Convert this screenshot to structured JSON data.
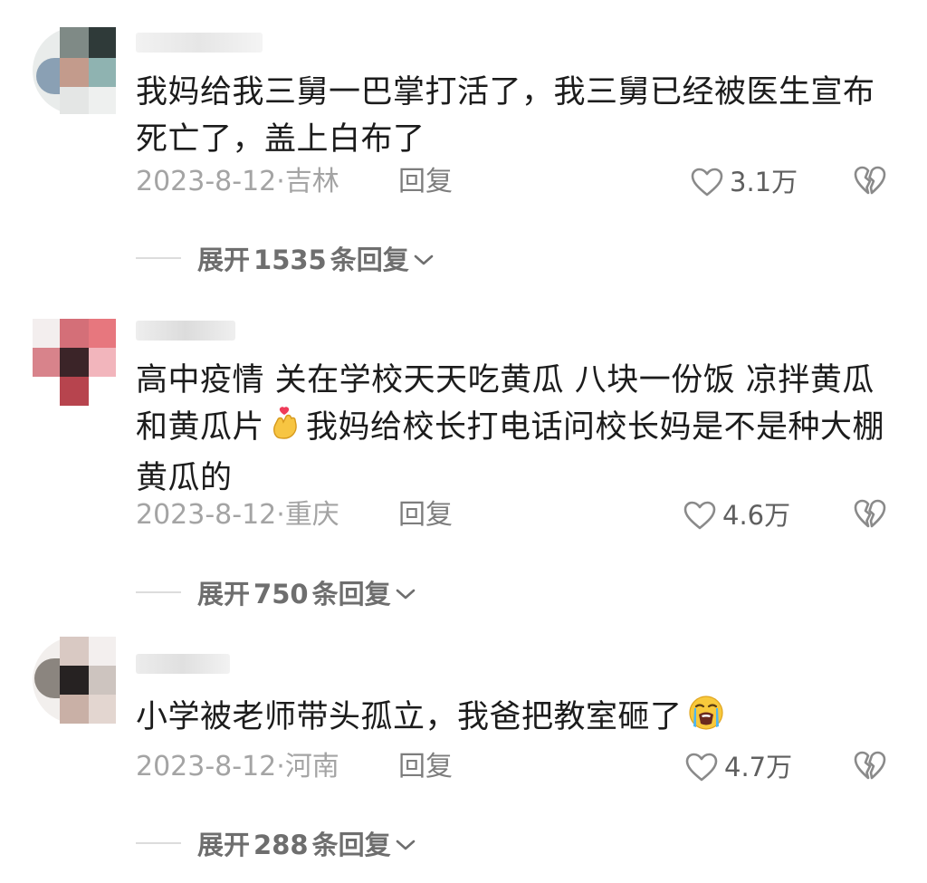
{
  "colors": {
    "text": "#1c1c1c",
    "meta": "#a4a4a4",
    "reply": "#7d7d7d",
    "count": "#5f5f5f",
    "expand": "#6e6e6e"
  },
  "comments": [
    {
      "text": "我妈给我三舅一巴掌打活了，我三舅已经被医生宣布死亡了，盖上白布了",
      "date": "2023-8-12",
      "separator": "·",
      "location": "吉林",
      "reply_label": "回复",
      "likes": "3.1万",
      "expand_prefix": "展开",
      "expand_count": "1535",
      "expand_suffix": "条回复",
      "like_icon": "heart-outline-icon",
      "dislike_icon": "broken-heart-icon"
    },
    {
      "text_part1": "高中疫情 关在学校天天吃黄瓜 八块一份饭 凉拌黄瓜和黄瓜片",
      "emoji1": "finger-heart-emoji",
      "text_part2": "我妈给校长打电话问校长妈是不是种大棚黄瓜的",
      "date": "2023-8-12",
      "separator": "·",
      "location": "重庆",
      "reply_label": "回复",
      "likes": "4.6万",
      "expand_prefix": "展开",
      "expand_count": "750",
      "expand_suffix": "条回复",
      "like_icon": "heart-outline-icon",
      "dislike_icon": "broken-heart-icon"
    },
    {
      "text": "小学被老师带头孤立，我爸把教室砸了",
      "emoji": "loudly-crying-emoji",
      "date": "2023-8-12",
      "separator": "·",
      "location": "河南",
      "reply_label": "回复",
      "likes": "4.7万",
      "expand_prefix": "展开",
      "expand_count": "288",
      "expand_suffix": "条回复",
      "like_icon": "heart-outline-icon",
      "dislike_icon": "broken-heart-icon"
    }
  ]
}
